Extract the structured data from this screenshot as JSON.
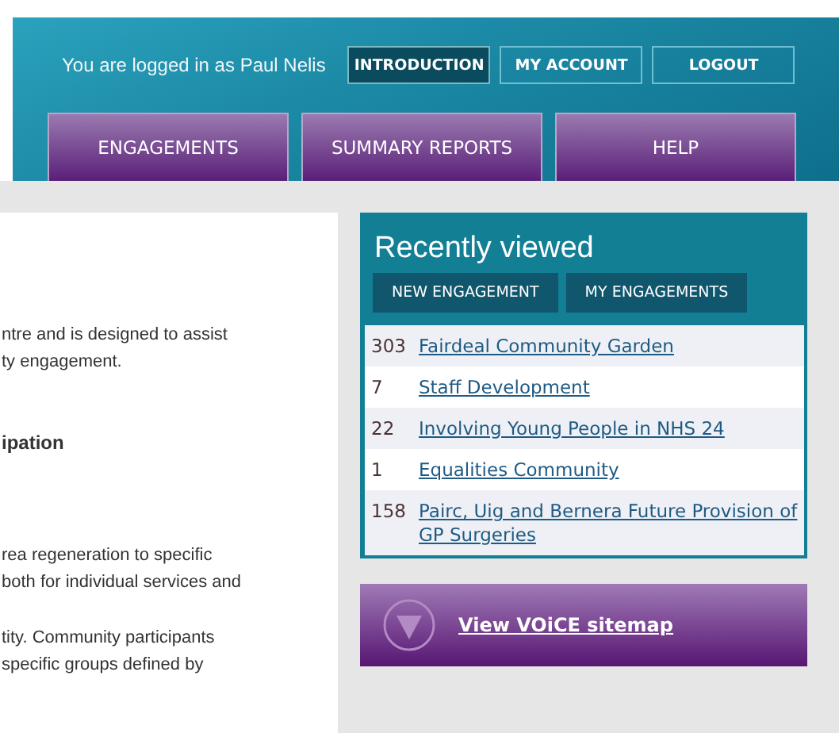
{
  "header": {
    "login_text": "You are logged in as Paul Nelis",
    "account_links": [
      {
        "label": "INTRODUCTION",
        "selected": true
      },
      {
        "label": "MY ACCOUNT",
        "selected": false
      },
      {
        "label": "LOGOUT",
        "selected": false
      }
    ],
    "nav_tabs": [
      {
        "label": "ENGAGEMENTS"
      },
      {
        "label": "SUMMARY REPORTS"
      },
      {
        "label": "HELP"
      }
    ]
  },
  "content": {
    "lines": [
      {
        "kind": "text",
        "text": "ntre and is designed to assist"
      },
      {
        "kind": "text",
        "text": "ty engagement."
      },
      {
        "kind": "heading",
        "text": "ipation"
      },
      {
        "kind": "text",
        "text": "rea regeneration to specific"
      },
      {
        "kind": "text",
        "text": "both for individual services and"
      },
      {
        "kind": "text",
        "text": "tity. Community participants"
      },
      {
        "kind": "text",
        "text": "specific groups defined by"
      }
    ]
  },
  "recently_viewed": {
    "title": "Recently viewed",
    "buttons": [
      "NEW ENGAGEMENT",
      "MY ENGAGEMENTS"
    ],
    "items": [
      {
        "number": "303",
        "title": "Fairdeal Community Garden"
      },
      {
        "number": "7",
        "title": "Staff Development"
      },
      {
        "number": "22",
        "title": "Involving Young People in NHS 24"
      },
      {
        "number": "1",
        "title": "Equalities Community"
      },
      {
        "number": "158",
        "title": "Pairc, Uig and Bernera Future Provision of GP Surgeries"
      }
    ]
  },
  "sitemap_link": "View VOiCE sitemap"
}
